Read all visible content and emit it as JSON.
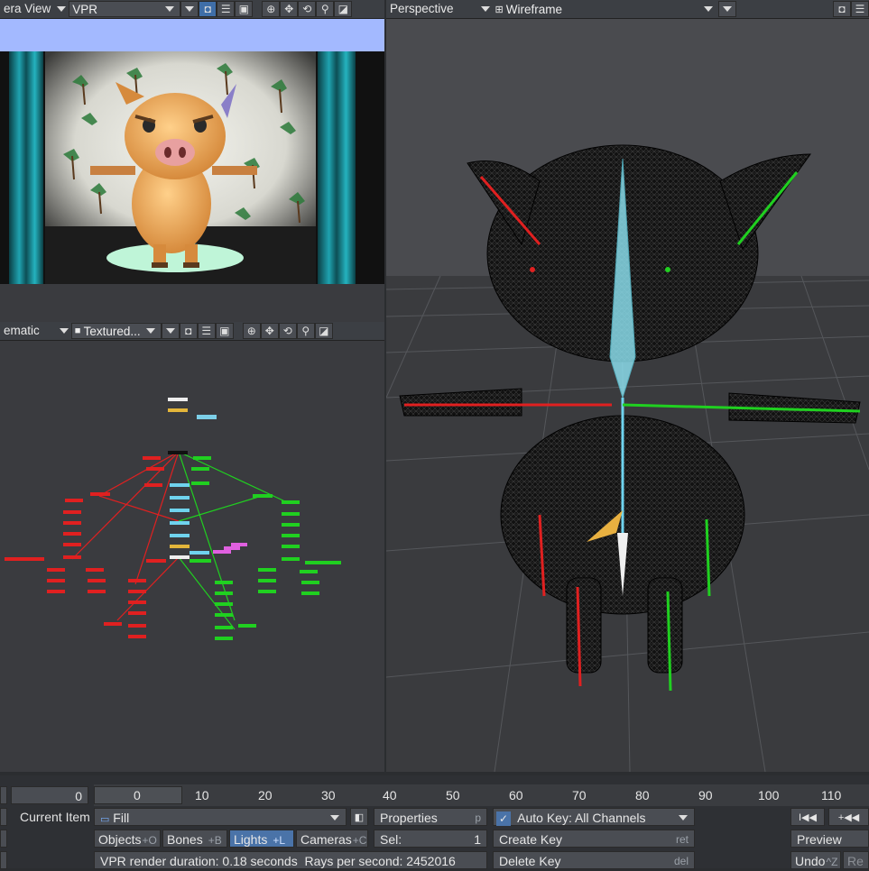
{
  "top_left_header": {
    "view_label": "era View",
    "renderer": "VPR"
  },
  "bottom_left_header": {
    "view_label": "ematic",
    "shading": "Textured..."
  },
  "right_header": {
    "view_label": "Perspective",
    "shading": "Wireframe"
  },
  "timeline": {
    "frame_value": "0",
    "ticks": [
      "0",
      "10",
      "20",
      "30",
      "40",
      "50",
      "60",
      "70",
      "80",
      "90",
      "100",
      "110"
    ]
  },
  "controls": {
    "current_item_label": "Current Item",
    "current_item_value": "Fill",
    "properties_label": "Properties",
    "properties_key": "p",
    "auto_key_label": "Auto Key: All Channels",
    "sel_label": "Sel:",
    "sel_value": "1",
    "create_key_label": "Create Key",
    "create_key_key": "ret",
    "delete_key_label": "Delete Key",
    "delete_key_key": "del",
    "objects_label": "Objects",
    "objects_key": "+O",
    "bones_label": "Bones",
    "bones_key": "+B",
    "lights_label": "Lights",
    "lights_key": "+L",
    "cameras_label": "Cameras",
    "cameras_key": "+C",
    "status": "VPR render duration: 0.18 seconds  Rays per second: 2452016",
    "preview_label": "Preview",
    "undo_label": "Undo",
    "undo_key": "^Z",
    "redo_label": "Re",
    "nav_first": "I◀◀",
    "nav_prev": "+◀◀"
  }
}
